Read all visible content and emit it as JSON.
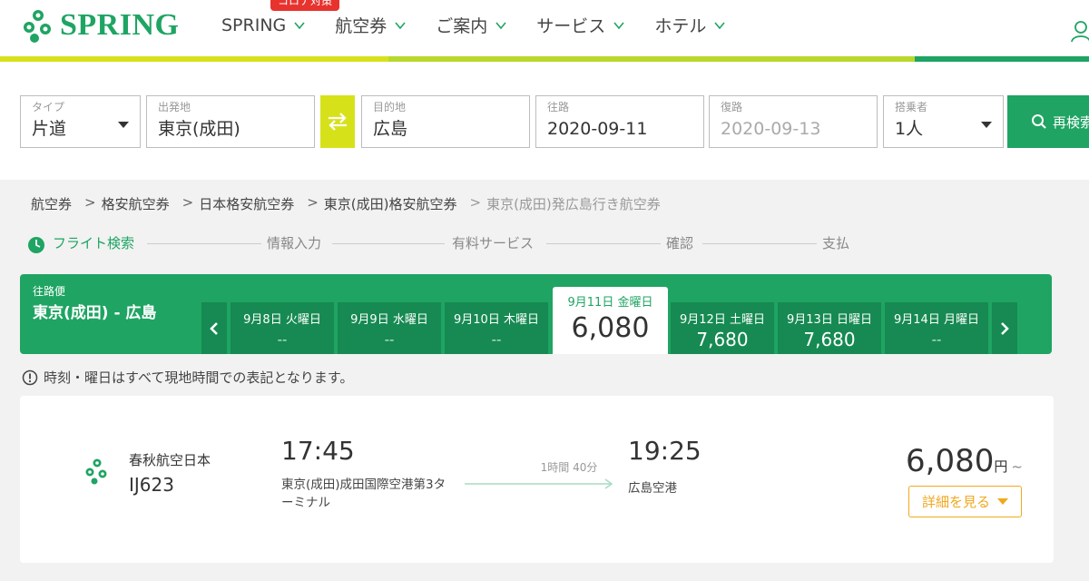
{
  "header": {
    "brand": "SPRING",
    "covid_badge": "コロナ対策",
    "nav": [
      "SPRING",
      "航空券",
      "ご案内",
      "サービス",
      "ホテル"
    ],
    "colors": {
      "brand_green": "#1fa463",
      "accent_yellow": "#d7e11a"
    }
  },
  "search": {
    "type": {
      "label": "タイプ",
      "value": "片道"
    },
    "origin": {
      "label": "出発地",
      "value": "東京(成田)"
    },
    "destination": {
      "label": "目的地",
      "value": "広島"
    },
    "outbound": {
      "label": "往路",
      "value": "2020-09-11"
    },
    "return": {
      "label": "復路",
      "value": "2020-09-13"
    },
    "passengers": {
      "label": "搭乗者",
      "value": "1人"
    },
    "research_label": "再検索"
  },
  "breadcrumb": [
    "航空券",
    "格安航空券",
    "日本格安航空券",
    "東京(成田)格安航空券",
    "東京(成田)発広島行き航空券"
  ],
  "steps": [
    "フライト検索",
    "情報入力",
    "有料サービス",
    "確認",
    "支払"
  ],
  "datebar": {
    "label": "往路便",
    "route": "東京(成田) - 広島",
    "dates": [
      {
        "date": "9月8日 火曜日",
        "price": "--"
      },
      {
        "date": "9月9日 水曜日",
        "price": "--"
      },
      {
        "date": "9月10日 木曜日",
        "price": "--"
      },
      {
        "date": "9月11日 金曜日",
        "price": "6,080",
        "selected": true
      },
      {
        "date": "9月12日 土曜日",
        "price": "7,680"
      },
      {
        "date": "9月13日 日曜日",
        "price": "7,680"
      },
      {
        "date": "9月14日 月曜日",
        "price": "--"
      }
    ]
  },
  "notice": "時刻・曜日はすべて現地時間での表記となります。",
  "flight": {
    "airline": "春秋航空日本",
    "number": "IJ623",
    "dep_time": "17:45",
    "dep_airport": "東京(成田)成田国際空港第3ターミナル",
    "duration": "1時間 40分",
    "arr_time": "19:25",
    "arr_airport": "広島空港",
    "price": "6,080",
    "currency": "円",
    "tilde": "~",
    "detail_label": "詳細を見る"
  }
}
